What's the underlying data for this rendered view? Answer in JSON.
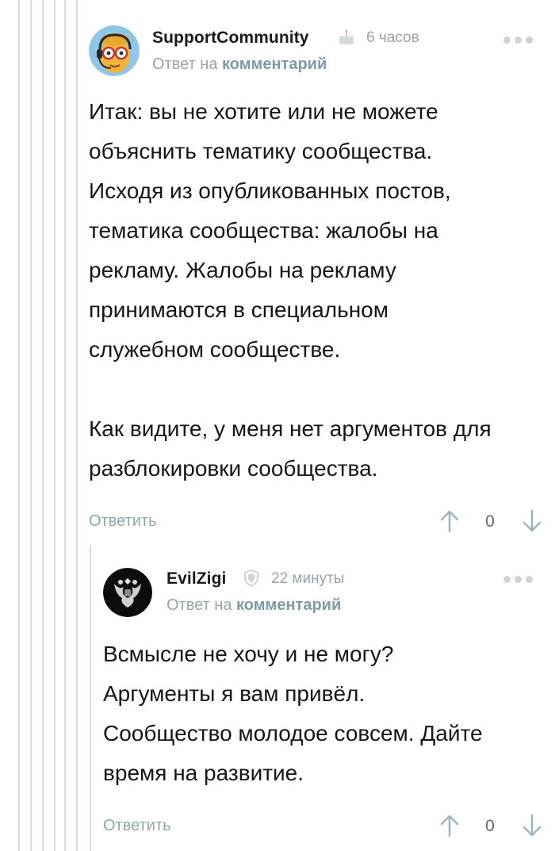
{
  "comments": [
    {
      "author": "SupportCommunity",
      "badge_icon": "cake-icon",
      "time": "6 часов",
      "reply_prefix": "Ответ на",
      "reply_link": "комментарий",
      "text": "Итак: вы не хотите или не можете\nобъяснить тематику сообщества.\nИсходя из опубликованных постов,\nтематика сообщества: жалобы на\nрекламу. Жалобы на рекламу\nпринимаются в специальном\nслужебном сообществе.\n\nКак видите, у меня нет аргументов для\nразблокировки сообщества.",
      "reply_label": "Ответить",
      "score": "0"
    },
    {
      "author": "EvilZigi",
      "badge_icon": "shield-icon",
      "time": "22 минуты",
      "reply_prefix": "Ответ на",
      "reply_link": "комментарий",
      "text": "Всмысле не хочу и не могу?\nАргументы я вам привёл.\nСообщество молодое совсем. Дайте\nвремя на развитие.",
      "reply_label": "Ответить",
      "score": "0"
    }
  ],
  "colors": {
    "thread_line": "#d9dde0",
    "meta_text": "#9aa3a8",
    "link": "#7e9aa5",
    "vote_arrow": "#9fb5bd"
  }
}
